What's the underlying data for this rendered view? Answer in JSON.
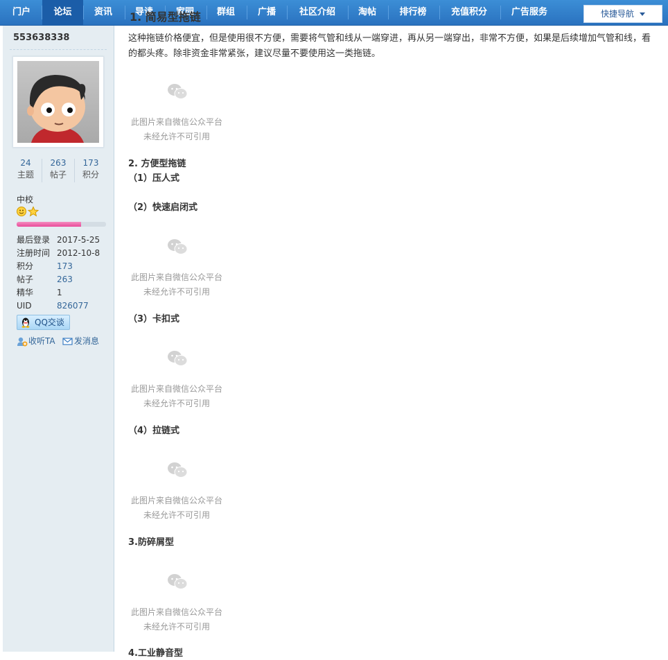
{
  "nav": {
    "items": [
      "门户",
      "论坛",
      "资讯",
      "导读",
      "家园",
      "群组",
      "广播",
      "社区介绍",
      "淘帖",
      "排行榜",
      "充值积分",
      "广告服务"
    ],
    "active": 1,
    "quick_nav": "快捷导航"
  },
  "sidebar": {
    "username": "553638338",
    "stats": [
      {
        "num": "24",
        "label": "主题"
      },
      {
        "num": "263",
        "label": "帖子"
      },
      {
        "num": "173",
        "label": "积分"
      }
    ],
    "rank": "中校",
    "rank_progress": 0.72,
    "info": [
      {
        "k": "最后登录",
        "v": "2017-5-25"
      },
      {
        "k": "注册时间",
        "v": "2012-10-8"
      },
      {
        "k": "积分",
        "v": "173"
      },
      {
        "k": "帖子",
        "v": "263"
      },
      {
        "k": "精华",
        "v": "1"
      },
      {
        "k": "UID",
        "v": "826077"
      }
    ],
    "qq_button": "QQ交谈",
    "follow": "收听TA",
    "message": "发消息"
  },
  "content": {
    "h1": "1. 简易型拖链",
    "intro": "这种拖链价格便宜，但是使用很不方便，需要将气管和线从一端穿进，再从另一端穿出，非常不方便，如果是后续增加气管和线，看的都头疼。除非资金非常紧张，建议尽量不要使用这一类拖链。",
    "image_note_1": "此图片来自微信公众平台",
    "image_note_2": "未经允许不可引用",
    "headings": [
      "2. 方便型拖链",
      "（1）压人式",
      "（2）快速启闭式",
      "（3）卡扣式",
      "（4）拉链式",
      "3.防碎屑型",
      "4.工业静音型"
    ]
  }
}
